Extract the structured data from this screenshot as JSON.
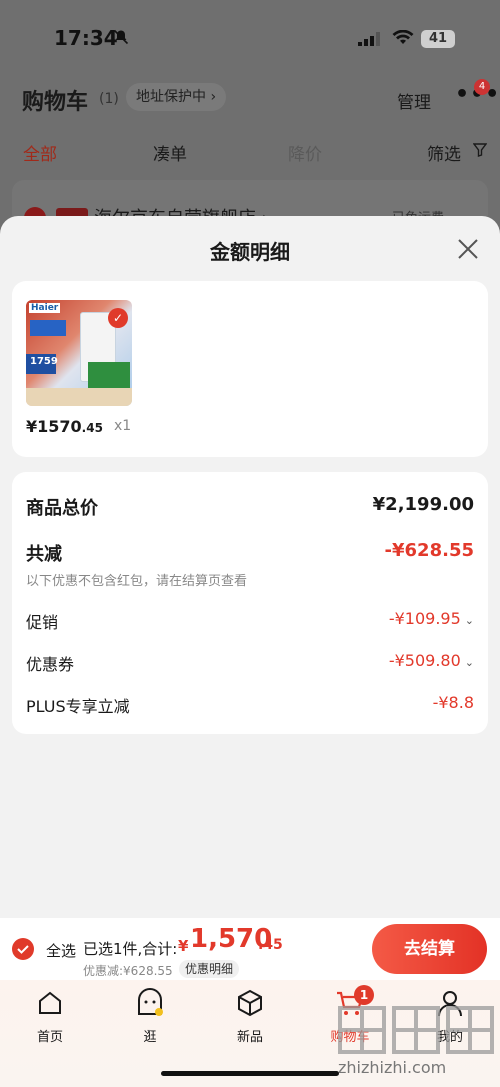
{
  "status": {
    "time": "17:34",
    "battery": "41"
  },
  "header": {
    "title": "购物车",
    "count": "(1)",
    "address": "地址保护中 ›",
    "manage": "管理",
    "more": "•••",
    "more_badge": "4"
  },
  "tabs": [
    "全部",
    "凑单",
    "降价",
    "筛选"
  ],
  "shop": {
    "name": "海尔京东自营旗舰店 ›",
    "shipping": "已免运费"
  },
  "sheet": {
    "title": "金额明细",
    "item": {
      "price_main": "¥1570",
      "price_dec": ".45",
      "qty": "x1",
      "thumb_brand": "Haier",
      "thumb_price": "1759"
    },
    "total_label": "商品总价",
    "total_value": "¥2,199.00",
    "off_label": "共减",
    "off_value": "-¥628.55",
    "note": "以下优惠不包含红包，请在结算页查看",
    "promo_label": "促销",
    "promo_value": "-¥109.95",
    "coupon_label": "优惠券",
    "coupon_value": "-¥509.80",
    "plus_label": "PLUS专享立减",
    "plus_value": "-¥8.8"
  },
  "bottom": {
    "select_all": "全选",
    "selected": "已选1件,合计:",
    "currency": "¥",
    "amount_int": "1,570",
    "amount_dec": ".45",
    "discount": "优惠减:¥628.55",
    "detail": "优惠明细",
    "checkout": "去结算"
  },
  "nav": {
    "home": "首页",
    "browse": "逛",
    "new": "新品",
    "cart": "购物车",
    "mine": "我的",
    "cart_badge": "1"
  },
  "watermark": "zhizhizhi.com",
  "colors": {
    "accent": "#e2392b",
    "sheet_bg": "#f2f2f2"
  }
}
